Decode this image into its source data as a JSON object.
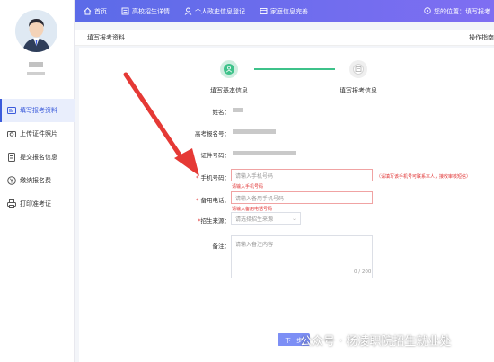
{
  "sidebar": {
    "menu": [
      {
        "label": "填写报考资料",
        "icon": "id-card-icon",
        "active": true
      },
      {
        "label": "上传证件照片",
        "icon": "camera-icon",
        "active": false
      },
      {
        "label": "提交报名信息",
        "icon": "document-icon",
        "active": false
      },
      {
        "label": "缴纳报名费",
        "icon": "yen-icon",
        "active": false
      },
      {
        "label": "打印准考证",
        "icon": "printer-icon",
        "active": false
      }
    ]
  },
  "topnav": {
    "items": [
      {
        "label": "首页",
        "icon": "home-icon"
      },
      {
        "label": "高校招生详情",
        "icon": "book-icon"
      },
      {
        "label": "个人政史信息登记",
        "icon": "user-icon"
      },
      {
        "label": "家庭信息完善",
        "icon": "house-form-icon"
      }
    ],
    "location": "您的位置：",
    "location_page": "填写报考"
  },
  "subbar": {
    "title": "填写报考资料",
    "guide": "操作指南"
  },
  "steps": [
    {
      "label": "填写基本信息",
      "state": "active"
    },
    {
      "label": "填写报考信息",
      "state": "pending"
    }
  ],
  "form": {
    "name_label": "姓名：",
    "exam_no_label": "高考报名号：",
    "id_no_label": "证件号码：",
    "phone": {
      "label": "手机号码：",
      "placeholder": "请输入手机号码",
      "error": "请输入手机号码",
      "note": "（请填写该手机号可联系本人，接收审核短信）"
    },
    "backup_phone": {
      "label": "备用电话：",
      "placeholder": "请输入备用手机号码",
      "error": "请输入备用电话号码"
    },
    "source": {
      "label": "招生来源：",
      "placeholder": "请选择招生来源"
    },
    "remark": {
      "label": "备注：",
      "placeholder": "请输入备注内容",
      "counter": "0 / 200"
    },
    "next": "下一步"
  },
  "watermark": "公众号 · 杨凌职院招生就业处",
  "colors": {
    "accent": "#3b5bdb",
    "success": "#3ec28a",
    "error": "#e03131",
    "arrow": "#e53935"
  }
}
